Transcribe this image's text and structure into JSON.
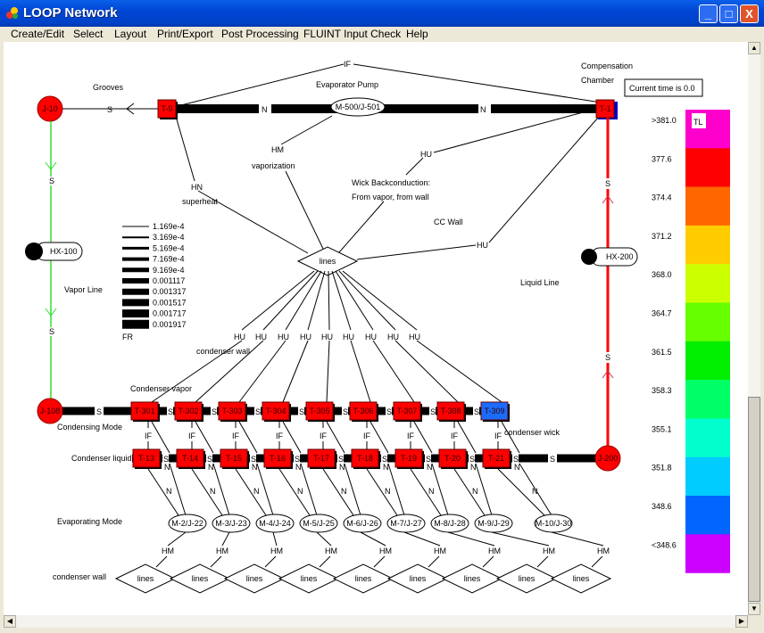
{
  "window": {
    "title": "LOOP Network",
    "minimize": "_",
    "maximize": "□",
    "close": "X"
  },
  "menu": [
    "Create/Edit",
    "Select",
    "Layout",
    "Print/Export",
    "Post Processing",
    "FLUINT Input Check",
    "Help"
  ],
  "status": {
    "current_time": "Current time is 0.0"
  },
  "labels": {
    "grooves": "Grooves",
    "evaporator_pump": "Evaporator Pump",
    "compensation": "Compensation",
    "chamber": "Chamber",
    "vaporization": "vaporization",
    "superheat": "superheat",
    "wick1": "Wick Backconduction:",
    "wick2": "From vapor, from wall",
    "cc_wall": "CC Wall",
    "liquid_line": "Liquid Line",
    "vapor_line": "Vapor Line",
    "condenser_wall_top": "condenser wall",
    "condenser_vapor": "Condenser vapor",
    "condensing_mode": "Condensing Mode",
    "condenser_liquid": "Condenser liquid",
    "condenser_wick": "condenser wick",
    "evaporating_mode": "Evaporating Mode",
    "condenser_wall_bottom": "condenser wall"
  },
  "conn": {
    "IF": "IF",
    "N": "N",
    "S": "S",
    "HM": "HM",
    "HN": "HN",
    "HU": "HU",
    "lines": "lines"
  },
  "nodes": {
    "J10": "J-10",
    "J108": "J-108",
    "J200": "J-200",
    "T9": "T-9",
    "T1": "T-1",
    "pump": "M-500/J-501",
    "hx100": "HX-100",
    "hx200": "HX-200"
  },
  "condenser_vapor_tanks": [
    "T-301",
    "T-302",
    "T-303",
    "T-304",
    "T-305",
    "T-306",
    "T-307",
    "T-308",
    "T-309"
  ],
  "condenser_liquid_tanks": [
    "T-13",
    "T-14",
    "T-15",
    "T-16",
    "T-17",
    "T-18",
    "T-19",
    "T-20",
    "T-21"
  ],
  "evap_modes": [
    "M-2/J-22",
    "M-3/J-23",
    "M-4/J-24",
    "M-5/J-25",
    "M-6/J-26",
    "M-7/J-27",
    "M-8/J-28",
    "M-9/J-29",
    "M-10/J-30"
  ],
  "flow_legend": {
    "title": "FR",
    "values": [
      "1.169e-4",
      "3.169e-4",
      "5.169e-4",
      "7.169e-4",
      "9.169e-4",
      "0.001117",
      "0.001317",
      "0.001517",
      "0.001717",
      "0.001917"
    ]
  },
  "temp_legend": {
    "tag": "TL",
    "labels": [
      ">381.0",
      "377.6",
      "374.4",
      "371.2",
      "368.0",
      "364.7",
      "361.5",
      "358.3",
      "355.1",
      "351.8",
      "348.6",
      "<348.6"
    ],
    "colors": [
      "#ff00cc",
      "#ff0000",
      "#ff6600",
      "#ffcc00",
      "#ccff00",
      "#66ff00",
      "#00ee00",
      "#00ff66",
      "#00ffcc",
      "#00ccff",
      "#0066ff",
      "#cc00ff"
    ]
  },
  "colors": {
    "tank_hot": "#ff0000",
    "tank_cool": "#1a6cff",
    "vapor_line": "#33dd33",
    "liquid_line": "#ff0000"
  }
}
